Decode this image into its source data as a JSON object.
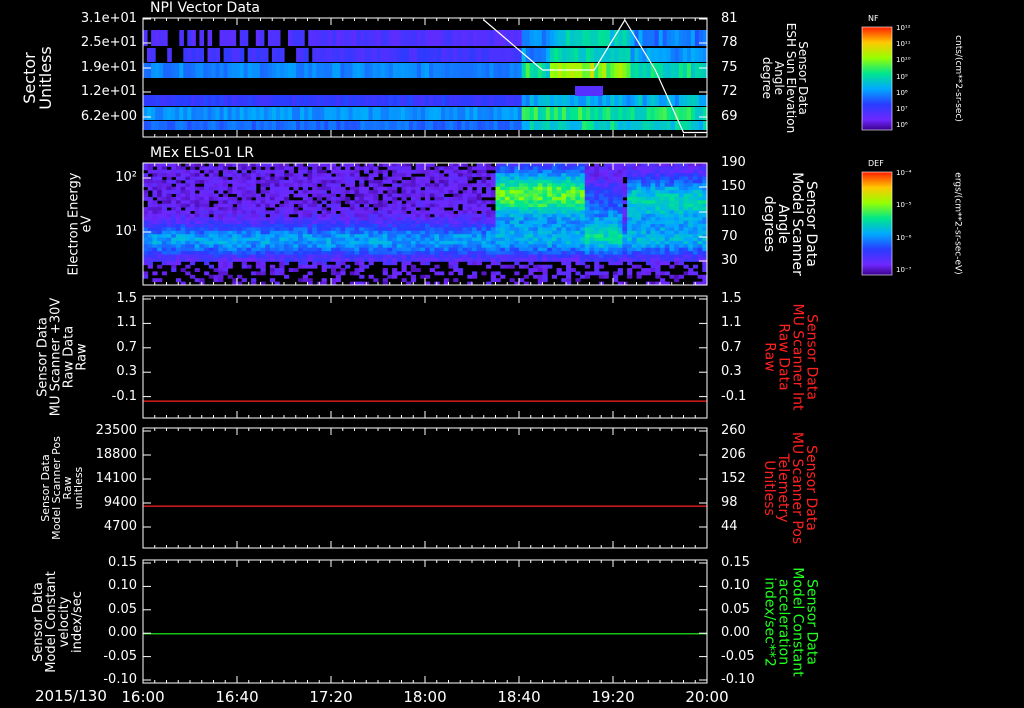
{
  "date_label": "2015/130",
  "time_ticks": [
    "16:00",
    "16:40",
    "17:20",
    "18:00",
    "18:40",
    "19:20",
    "20:00"
  ],
  "colorbars": [
    {
      "name": "NF",
      "unit": "cnts/(cm**2-sr-sec)",
      "ticks": [
        "10¹²",
        "10¹¹",
        "10¹⁰",
        "10⁹",
        "10⁸",
        "10⁷",
        "10⁶"
      ]
    },
    {
      "name": "DEF",
      "unit": "ergs/(cm**2-sr-sec-eV)",
      "ticks": [
        "10⁻⁴",
        "10⁻⁵",
        "10⁻⁶",
        "10⁻⁷"
      ]
    }
  ],
  "panels": [
    {
      "id": "npi",
      "title": "NPI Vector Data",
      "left_label": "Sector\nUnitless",
      "right_label": "Sensor Data\nESH Sun Elevation\nAngle\ndegree",
      "right_color": "#ffffff",
      "left_ticks": [
        "3.1e+01",
        "2.5e+01",
        "1.9e+01",
        "1.2e+01",
        "6.2e+00"
      ],
      "right_ticks": [
        "81",
        "78",
        "75",
        "72",
        "69"
      ]
    },
    {
      "id": "els",
      "title": "MEx ELS-01 LR",
      "left_label": "Electron Energy\neV",
      "right_label": "Sensor Data\nModel Scanner\nAngle\ndegrees",
      "right_color": "#ffffff",
      "left_ticks": [
        "10²",
        "10¹"
      ],
      "right_ticks": [
        "190",
        "150",
        "110",
        "70",
        "30"
      ]
    },
    {
      "id": "mu30",
      "title": "",
      "left_label": "Sensor Data\nMU Scanner +30V\nRaw Data\nRaw",
      "right_label": "Sensor Data\nMU Scanner Int\nRaw Data\nRaw",
      "right_color": "#ff2020",
      "left_ticks": [
        "1.5",
        "1.1",
        "0.7",
        "0.3",
        "-0.1"
      ],
      "right_ticks": [
        "1.5",
        "1.1",
        "0.7",
        "0.3",
        "-0.1"
      ]
    },
    {
      "id": "scanpos",
      "title": "",
      "left_label": "Sensor Data\nModel Scanner Pos\nRaw\nunitless",
      "right_label": "Sensor Data\nMU Scanner Pos\nTelemetry\nUnitless",
      "right_color": "#ff2020",
      "left_ticks": [
        "23500",
        "18800",
        "14100",
        "9400",
        "4700"
      ],
      "right_ticks": [
        "260",
        "206",
        "152",
        "98",
        "44"
      ]
    },
    {
      "id": "velocity",
      "title": "",
      "left_label": "Sensor Data\nModel Constant\nvelocity\nindex/sec",
      "right_label": "Sensor Data\nModel Constant\nacceleration\nindex/sec**2",
      "right_color": "#20ff20",
      "left_ticks": [
        "0.15",
        "0.10",
        "0.05",
        "0.00",
        "-0.05",
        "-0.10"
      ],
      "right_ticks": [
        "0.15",
        "0.10",
        "0.05",
        "0.00",
        "-0.05",
        "-0.10"
      ]
    }
  ],
  "chart_data": [
    {
      "type": "heatmap",
      "panel": "npi",
      "x_range": [
        "16:00",
        "20:00"
      ],
      "description_source": "spectrogram, sector vs time",
      "line_series": {
        "name": "Sensor Data ESH Sun Elevation Angle",
        "color": "#ffffff",
        "points": [
          [
            "18:25",
            81
          ],
          [
            "18:50",
            75
          ],
          [
            "19:12",
            75
          ],
          [
            "19:25",
            81
          ],
          [
            "19:38",
            75
          ],
          [
            "19:50",
            67.5
          ],
          [
            "20:00",
            67.5
          ]
        ]
      }
    },
    {
      "type": "heatmap",
      "panel": "els",
      "x_range": [
        "16:00",
        "20:00"
      ],
      "ylabel": "Electron Energy eV",
      "yscale": "log"
    },
    {
      "type": "line",
      "panel": "mu30",
      "ylim": [
        -0.3,
        1.5
      ],
      "series": [
        {
          "color": "#ff2020",
          "x": [
            "16:00",
            "20:00"
          ],
          "y": [
            -0.05,
            -0.05
          ]
        }
      ]
    },
    {
      "type": "line",
      "panel": "scanpos",
      "ylim": [
        0,
        23500
      ],
      "series": [
        {
          "color": "#ff2020",
          "x": [
            "16:00",
            "20:00"
          ],
          "y": [
            8200,
            8200
          ]
        }
      ]
    },
    {
      "type": "line",
      "panel": "velocity",
      "ylim": [
        -0.1,
        0.15
      ],
      "series": [
        {
          "color": "#20ff20",
          "x": [
            "16:00",
            "20:00"
          ],
          "y": [
            0.0,
            0.0
          ]
        }
      ]
    }
  ]
}
